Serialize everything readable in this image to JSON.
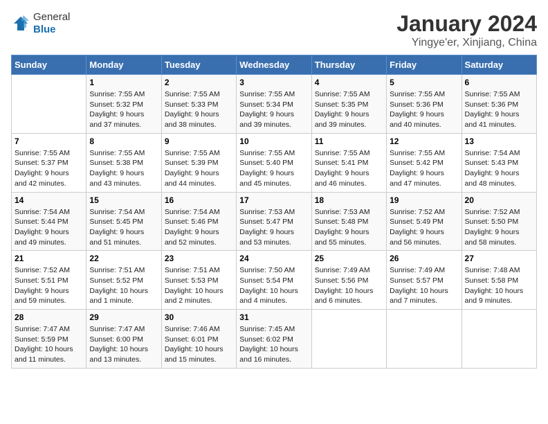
{
  "logo": {
    "general": "General",
    "blue": "Blue"
  },
  "title": "January 2024",
  "subtitle": "Yingye'er, Xinjiang, China",
  "header_row": [
    "Sunday",
    "Monday",
    "Tuesday",
    "Wednesday",
    "Thursday",
    "Friday",
    "Saturday"
  ],
  "weeks": [
    [
      {
        "day": "",
        "info": ""
      },
      {
        "day": "1",
        "info": "Sunrise: 7:55 AM\nSunset: 5:32 PM\nDaylight: 9 hours\nand 37 minutes."
      },
      {
        "day": "2",
        "info": "Sunrise: 7:55 AM\nSunset: 5:33 PM\nDaylight: 9 hours\nand 38 minutes."
      },
      {
        "day": "3",
        "info": "Sunrise: 7:55 AM\nSunset: 5:34 PM\nDaylight: 9 hours\nand 39 minutes."
      },
      {
        "day": "4",
        "info": "Sunrise: 7:55 AM\nSunset: 5:35 PM\nDaylight: 9 hours\nand 39 minutes."
      },
      {
        "day": "5",
        "info": "Sunrise: 7:55 AM\nSunset: 5:36 PM\nDaylight: 9 hours\nand 40 minutes."
      },
      {
        "day": "6",
        "info": "Sunrise: 7:55 AM\nSunset: 5:36 PM\nDaylight: 9 hours\nand 41 minutes."
      }
    ],
    [
      {
        "day": "7",
        "info": "Sunrise: 7:55 AM\nSunset: 5:37 PM\nDaylight: 9 hours\nand 42 minutes."
      },
      {
        "day": "8",
        "info": "Sunrise: 7:55 AM\nSunset: 5:38 PM\nDaylight: 9 hours\nand 43 minutes."
      },
      {
        "day": "9",
        "info": "Sunrise: 7:55 AM\nSunset: 5:39 PM\nDaylight: 9 hours\nand 44 minutes."
      },
      {
        "day": "10",
        "info": "Sunrise: 7:55 AM\nSunset: 5:40 PM\nDaylight: 9 hours\nand 45 minutes."
      },
      {
        "day": "11",
        "info": "Sunrise: 7:55 AM\nSunset: 5:41 PM\nDaylight: 9 hours\nand 46 minutes."
      },
      {
        "day": "12",
        "info": "Sunrise: 7:55 AM\nSunset: 5:42 PM\nDaylight: 9 hours\nand 47 minutes."
      },
      {
        "day": "13",
        "info": "Sunrise: 7:54 AM\nSunset: 5:43 PM\nDaylight: 9 hours\nand 48 minutes."
      }
    ],
    [
      {
        "day": "14",
        "info": "Sunrise: 7:54 AM\nSunset: 5:44 PM\nDaylight: 9 hours\nand 49 minutes."
      },
      {
        "day": "15",
        "info": "Sunrise: 7:54 AM\nSunset: 5:45 PM\nDaylight: 9 hours\nand 51 minutes."
      },
      {
        "day": "16",
        "info": "Sunrise: 7:54 AM\nSunset: 5:46 PM\nDaylight: 9 hours\nand 52 minutes."
      },
      {
        "day": "17",
        "info": "Sunrise: 7:53 AM\nSunset: 5:47 PM\nDaylight: 9 hours\nand 53 minutes."
      },
      {
        "day": "18",
        "info": "Sunrise: 7:53 AM\nSunset: 5:48 PM\nDaylight: 9 hours\nand 55 minutes."
      },
      {
        "day": "19",
        "info": "Sunrise: 7:52 AM\nSunset: 5:49 PM\nDaylight: 9 hours\nand 56 minutes."
      },
      {
        "day": "20",
        "info": "Sunrise: 7:52 AM\nSunset: 5:50 PM\nDaylight: 9 hours\nand 58 minutes."
      }
    ],
    [
      {
        "day": "21",
        "info": "Sunrise: 7:52 AM\nSunset: 5:51 PM\nDaylight: 9 hours\nand 59 minutes."
      },
      {
        "day": "22",
        "info": "Sunrise: 7:51 AM\nSunset: 5:52 PM\nDaylight: 10 hours\nand 1 minute."
      },
      {
        "day": "23",
        "info": "Sunrise: 7:51 AM\nSunset: 5:53 PM\nDaylight: 10 hours\nand 2 minutes."
      },
      {
        "day": "24",
        "info": "Sunrise: 7:50 AM\nSunset: 5:54 PM\nDaylight: 10 hours\nand 4 minutes."
      },
      {
        "day": "25",
        "info": "Sunrise: 7:49 AM\nSunset: 5:56 PM\nDaylight: 10 hours\nand 6 minutes."
      },
      {
        "day": "26",
        "info": "Sunrise: 7:49 AM\nSunset: 5:57 PM\nDaylight: 10 hours\nand 7 minutes."
      },
      {
        "day": "27",
        "info": "Sunrise: 7:48 AM\nSunset: 5:58 PM\nDaylight: 10 hours\nand 9 minutes."
      }
    ],
    [
      {
        "day": "28",
        "info": "Sunrise: 7:47 AM\nSunset: 5:59 PM\nDaylight: 10 hours\nand 11 minutes."
      },
      {
        "day": "29",
        "info": "Sunrise: 7:47 AM\nSunset: 6:00 PM\nDaylight: 10 hours\nand 13 minutes."
      },
      {
        "day": "30",
        "info": "Sunrise: 7:46 AM\nSunset: 6:01 PM\nDaylight: 10 hours\nand 15 minutes."
      },
      {
        "day": "31",
        "info": "Sunrise: 7:45 AM\nSunset: 6:02 PM\nDaylight: 10 hours\nand 16 minutes."
      },
      {
        "day": "",
        "info": ""
      },
      {
        "day": "",
        "info": ""
      },
      {
        "day": "",
        "info": ""
      }
    ]
  ]
}
